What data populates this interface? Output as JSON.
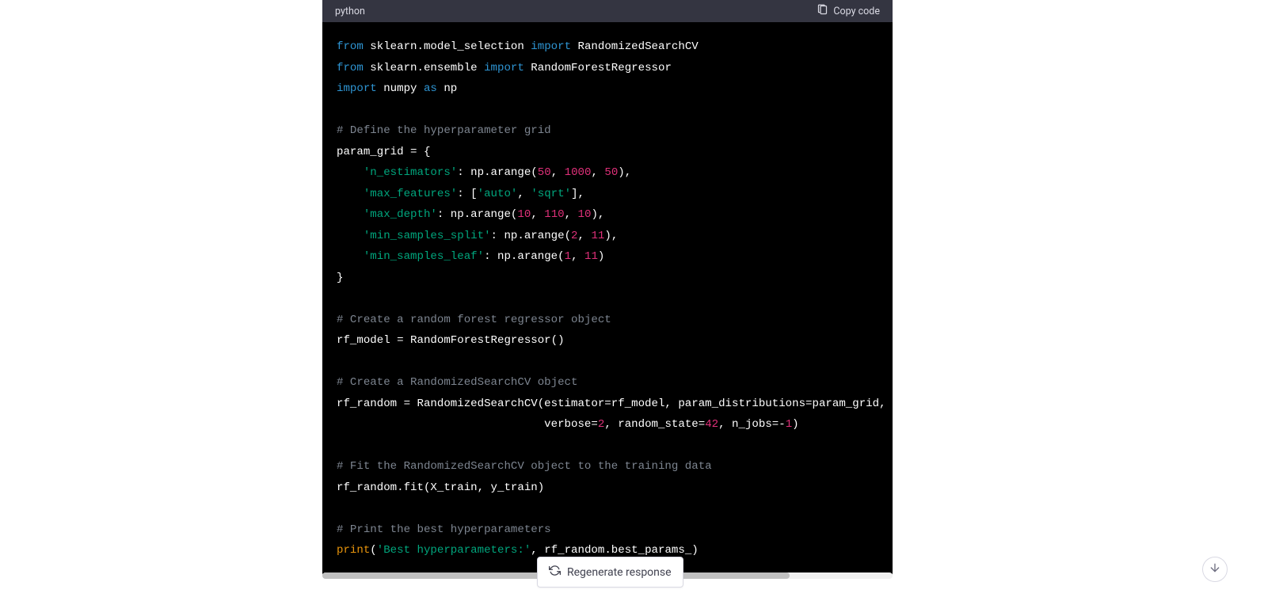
{
  "header": {
    "language": "python",
    "copy_label": "Copy code"
  },
  "regen_label": "Regenerate response",
  "code": {
    "tokens": [
      [
        [
          "kw",
          "from"
        ],
        [
          "",
          " sklearn.model_selection "
        ],
        [
          "kw",
          "import"
        ],
        [
          "",
          " RandomizedSearchCV"
        ]
      ],
      [
        [
          "kw",
          "from"
        ],
        [
          "",
          " sklearn.ensemble "
        ],
        [
          "kw",
          "import"
        ],
        [
          "",
          " RandomForestRegressor"
        ]
      ],
      [
        [
          "kw",
          "import"
        ],
        [
          "",
          " numpy "
        ],
        [
          "kw",
          "as"
        ],
        [
          "",
          " np"
        ]
      ],
      [],
      [
        [
          "cmt",
          "# Define the hyperparameter grid"
        ]
      ],
      [
        [
          "",
          "param_grid = {"
        ]
      ],
      [
        [
          "",
          "    "
        ],
        [
          "str",
          "'n_estimators'"
        ],
        [
          "",
          ": np.arange("
        ],
        [
          "num",
          "50"
        ],
        [
          "",
          ", "
        ],
        [
          "num",
          "1000"
        ],
        [
          "",
          ", "
        ],
        [
          "num",
          "50"
        ],
        [
          "",
          "),"
        ]
      ],
      [
        [
          "",
          "    "
        ],
        [
          "str",
          "'max_features'"
        ],
        [
          "",
          ": ["
        ],
        [
          "str",
          "'auto'"
        ],
        [
          "",
          ", "
        ],
        [
          "str",
          "'sqrt'"
        ],
        [
          "",
          "],"
        ]
      ],
      [
        [
          "",
          "    "
        ],
        [
          "str",
          "'max_depth'"
        ],
        [
          "",
          ": np.arange("
        ],
        [
          "num",
          "10"
        ],
        [
          "",
          ", "
        ],
        [
          "num",
          "110"
        ],
        [
          "",
          ", "
        ],
        [
          "num",
          "10"
        ],
        [
          "",
          "),"
        ]
      ],
      [
        [
          "",
          "    "
        ],
        [
          "str",
          "'min_samples_split'"
        ],
        [
          "",
          ": np.arange("
        ],
        [
          "num",
          "2"
        ],
        [
          "",
          ", "
        ],
        [
          "num",
          "11"
        ],
        [
          "",
          "),"
        ]
      ],
      [
        [
          "",
          "    "
        ],
        [
          "str",
          "'min_samples_leaf'"
        ],
        [
          "",
          ": np.arange("
        ],
        [
          "num",
          "1"
        ],
        [
          "",
          ", "
        ],
        [
          "num",
          "11"
        ],
        [
          "",
          ")"
        ]
      ],
      [
        [
          "",
          "}"
        ]
      ],
      [],
      [
        [
          "cmt",
          "# Create a random forest regressor object"
        ]
      ],
      [
        [
          "",
          "rf_model = RandomForestRegressor()"
        ]
      ],
      [],
      [
        [
          "cmt",
          "# Create a RandomizedSearchCV object"
        ]
      ],
      [
        [
          "",
          "rf_random = RandomizedSearchCV(estimator=rf_model, param_distributions=param_grid,"
        ]
      ],
      [
        [
          "",
          "                               verbose="
        ],
        [
          "num",
          "2"
        ],
        [
          "",
          ", random_state="
        ],
        [
          "num",
          "42"
        ],
        [
          "",
          ", n_jobs=-"
        ],
        [
          "num",
          "1"
        ],
        [
          "",
          ")"
        ]
      ],
      [],
      [
        [
          "cmt",
          "# Fit the RandomizedSearchCV object to the training data"
        ]
      ],
      [
        [
          "",
          "rf_random.fit(X_train, y_train)"
        ]
      ],
      [],
      [
        [
          "cmt",
          "# Print the best hyperparameters"
        ]
      ],
      [
        [
          "bi",
          "print"
        ],
        [
          "",
          "("
        ],
        [
          "str",
          "'Best hyperparameters:'"
        ],
        [
          "",
          ", rf_random.best_params_)"
        ]
      ]
    ]
  }
}
